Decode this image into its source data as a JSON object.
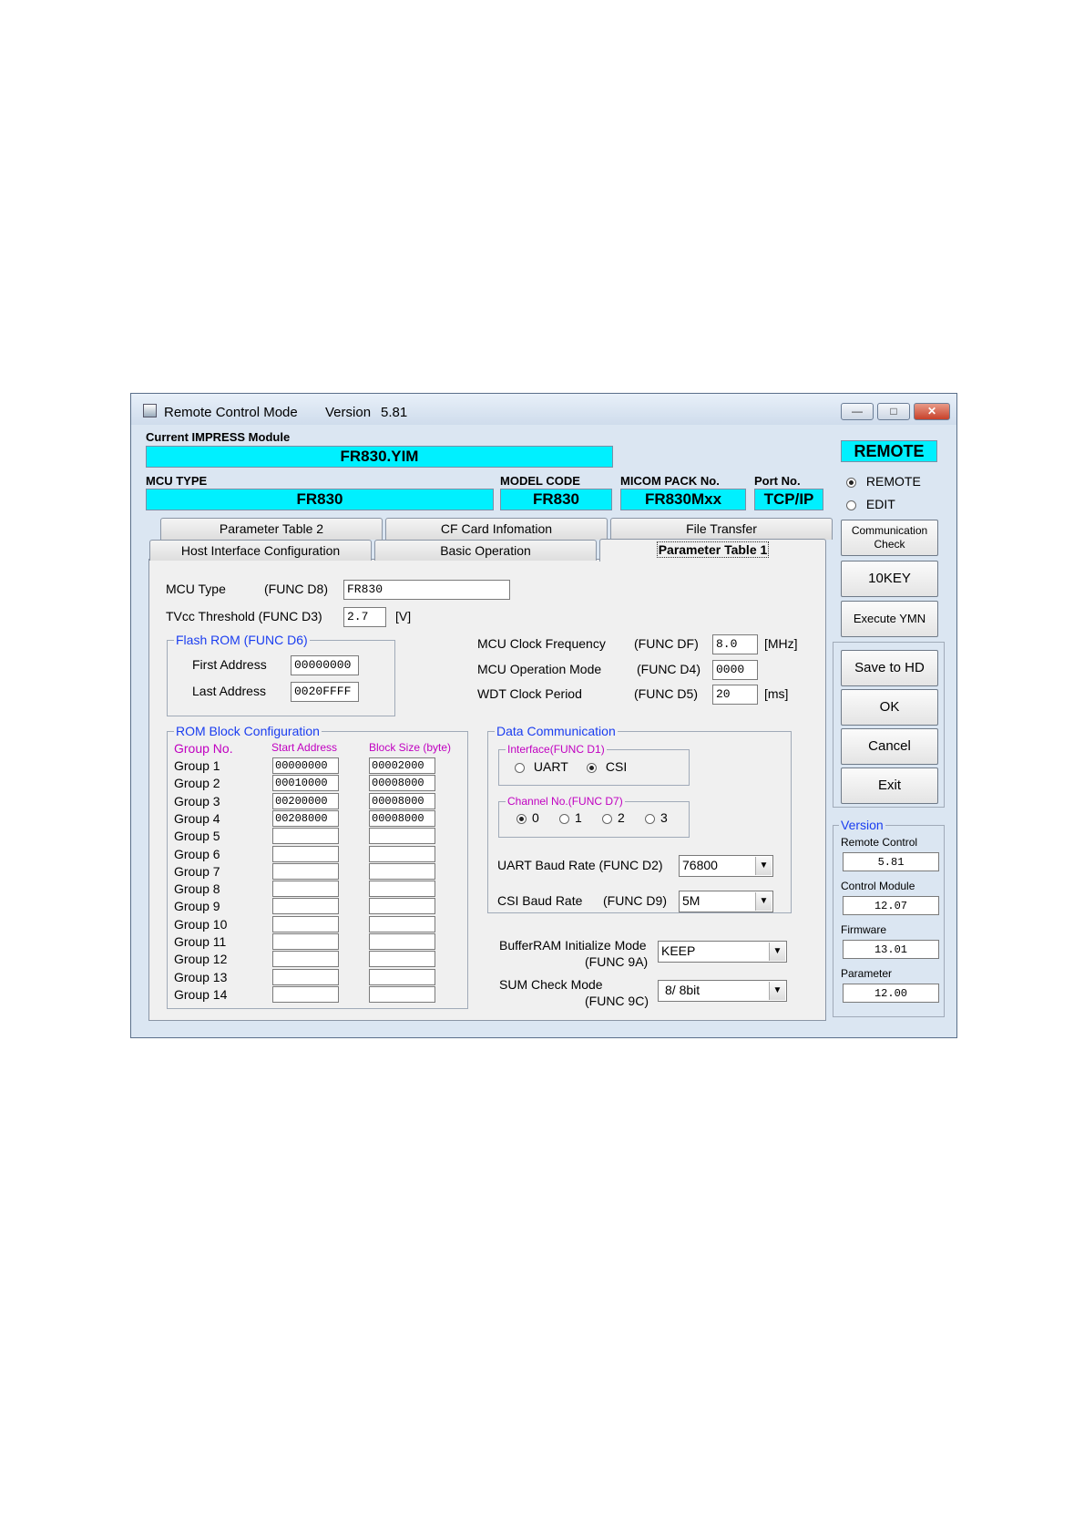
{
  "window": {
    "title": "Remote Control Mode",
    "version_label": "Version",
    "version_value": "5.81",
    "minimize": "—",
    "maximize": "□",
    "close": "✕"
  },
  "header": {
    "current_module_label": "Current IMPRESS Module",
    "current_module": "FR830.YIM",
    "mcu_type_label": "MCU TYPE",
    "mcu_type": "FR830",
    "model_code_label": "MODEL CODE",
    "model_code": "FR830",
    "micom_pack_label": "MICOM PACK No.",
    "micom_pack": "FR830Mxx",
    "port_label": "Port No.",
    "port": "TCP/IP",
    "mode_indicator": "REMOTE"
  },
  "mode": {
    "remote": "REMOTE",
    "edit": "EDIT",
    "selected": "REMOTE"
  },
  "tabs": {
    "row1": [
      "Parameter Table 2",
      "CF Card Infomation",
      "File Transfer"
    ],
    "row2": [
      "Host Interface Configuration",
      "Basic Operation",
      "Parameter Table 1"
    ],
    "active": "Parameter Table 1"
  },
  "params": {
    "mcu_type_label": "MCU Type",
    "mcu_type_func": "(FUNC D8)",
    "mcu_type_value": "FR830",
    "tvcc_label": "TVcc Threshold (FUNC D3)",
    "tvcc_value": "2.7",
    "tvcc_unit": "[V]",
    "flash_rom_title": "Flash ROM (FUNC D6)",
    "first_address_label": "First Address",
    "first_address": "00000000",
    "last_address_label": "Last Address",
    "last_address": "0020FFFF",
    "clock_freq_label": "MCU Clock Frequency",
    "clock_freq_func": "(FUNC DF)",
    "clock_freq_value": "8.0",
    "clock_freq_unit": "[MHz]",
    "op_mode_label": "MCU Operation Mode",
    "op_mode_func": "(FUNC D4)",
    "op_mode_value": "0000",
    "wdt_label": "WDT Clock Period",
    "wdt_func": "(FUNC D5)",
    "wdt_value": "20",
    "wdt_unit": "[ms]"
  },
  "rom_block": {
    "title": "ROM Block Configuration",
    "col_group": "Group No.",
    "col_start": "Start Address",
    "col_size": "Block Size (byte)",
    "rows": [
      {
        "group": "Group  1",
        "start": "00000000",
        "size": "00002000"
      },
      {
        "group": "Group  2",
        "start": "00010000",
        "size": "00008000"
      },
      {
        "group": "Group  3",
        "start": "00200000",
        "size": "00008000"
      },
      {
        "group": "Group  4",
        "start": "00208000",
        "size": "00008000"
      },
      {
        "group": "Group  5",
        "start": "",
        "size": ""
      },
      {
        "group": "Group  6",
        "start": "",
        "size": ""
      },
      {
        "group": "Group  7",
        "start": "",
        "size": ""
      },
      {
        "group": "Group  8",
        "start": "",
        "size": ""
      },
      {
        "group": "Group  9",
        "start": "",
        "size": ""
      },
      {
        "group": "Group 10",
        "start": "",
        "size": ""
      },
      {
        "group": "Group 11",
        "start": "",
        "size": ""
      },
      {
        "group": "Group 12",
        "start": "",
        "size": ""
      },
      {
        "group": "Group 13",
        "start": "",
        "size": ""
      },
      {
        "group": "Group 14",
        "start": "",
        "size": ""
      }
    ]
  },
  "data_comm": {
    "title": "Data Communication",
    "interface_title": "Interface(FUNC D1)",
    "interface_uart": "UART",
    "interface_csi": "CSI",
    "interface_selected": "CSI",
    "channel_title": "Channel No.(FUNC D7)",
    "channels": [
      "0",
      "1",
      "2",
      "3"
    ],
    "channel_selected": "0",
    "uart_baud_label": "UART Baud Rate (FUNC D2)",
    "uart_baud_value": "76800",
    "csi_baud_label": "CSI Baud Rate",
    "csi_baud_func": "(FUNC D9)",
    "csi_baud_value": "5M"
  },
  "buffer": {
    "label": "BufferRAM Initialize Mode",
    "func": "(FUNC 9A)",
    "value": "KEEP"
  },
  "sum_check": {
    "label": "SUM Check Mode",
    "func": "(FUNC 9C)",
    "value": "8/ 8bit"
  },
  "side_buttons": {
    "comm_check_line1": "Communication",
    "comm_check_line2": "Check",
    "tenkey": "10KEY",
    "execute": "Execute YMN",
    "save": "Save to HD",
    "ok": "OK",
    "cancel": "Cancel",
    "exit": "Exit"
  },
  "version_panel": {
    "title": "Version",
    "remote_label": "Remote Control",
    "remote_value": "5.81",
    "control_label": "Control Module",
    "control_value": "12.07",
    "firmware_label": "Firmware",
    "firmware_value": "13.01",
    "parameter_label": "Parameter",
    "parameter_value": "12.00"
  },
  "icons": {
    "dropdown": "▼"
  }
}
